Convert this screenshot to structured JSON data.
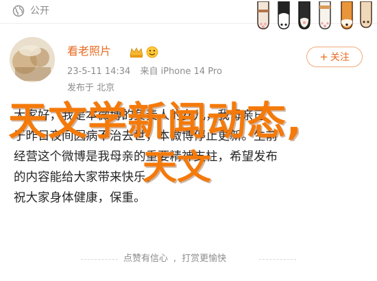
{
  "header": {
    "visibility": "公开",
    "globe_icon": "globe-icon",
    "stickers": [
      "cat-paw-sticker",
      "penguin-sticker",
      "bear-sticker",
      "cat-sticker",
      "fox-sticker"
    ]
  },
  "profile": {
    "username": "看老照片",
    "datetime": "23-5-11 14:34",
    "source": "来自 iPhone 14 Pro",
    "location": "发布于 北京",
    "follow_label": "关注",
    "accent_color": "#e86a21"
  },
  "post": {
    "lines": [
      "大家好，我是本微博的负责人的女儿，我母亲已",
      "于昨日夜间因病不治去世，本微博停止更新。生前",
      "经营这个微博是我母亲的重要精神支柱，希望发布",
      "的内容能给大家带来快乐。",
      "祝大家身体健康，保重。"
    ]
  },
  "overlay": {
    "line1": "天文学新闻动态,",
    "line2": "天文",
    "color": "#f47a0a"
  },
  "footer": {
    "like_text": "点赞有信心",
    "reward_text": "打赏更愉快"
  }
}
